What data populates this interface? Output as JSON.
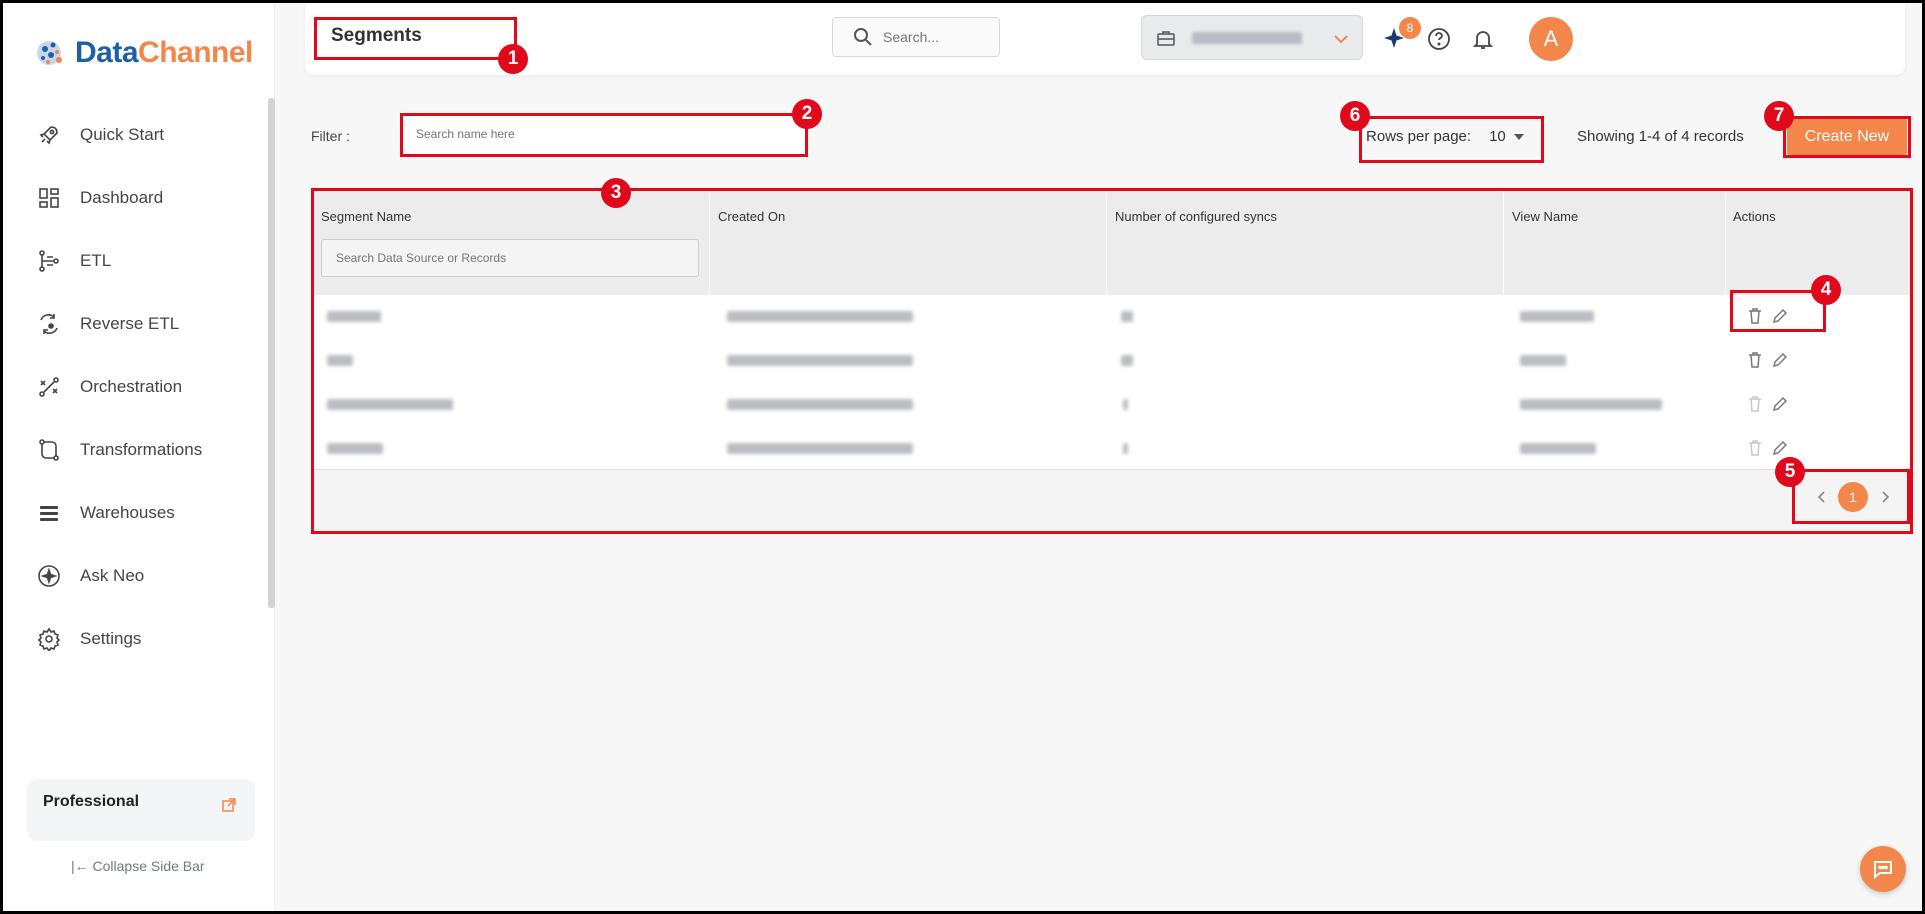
{
  "brand": {
    "name_part1": "Data",
    "name_part2": "Channel"
  },
  "sidebar": {
    "items": [
      {
        "label": "Quick Start",
        "icon": "rocket-icon"
      },
      {
        "label": "Dashboard",
        "icon": "dashboard-icon"
      },
      {
        "label": "ETL",
        "icon": "etl-icon"
      },
      {
        "label": "Reverse ETL",
        "icon": "reverse-etl-icon"
      },
      {
        "label": "Orchestration",
        "icon": "orchestration-icon"
      },
      {
        "label": "Transformations",
        "icon": "transformations-icon"
      },
      {
        "label": "Warehouses",
        "icon": "warehouses-icon"
      },
      {
        "label": "Ask Neo",
        "icon": "sparkle-icon"
      },
      {
        "label": "Settings",
        "icon": "gear-icon"
      }
    ],
    "plan": "Professional",
    "collapse_label": "|← Collapse Side Bar"
  },
  "header": {
    "title": "Segments",
    "search_placeholder": "Search...",
    "neo_badge_count": "8",
    "avatar_initial": "A"
  },
  "toolbar": {
    "filter_label": "Filter :",
    "filter_placeholder": "Search name here",
    "rows_per_page_label": "Rows per page:",
    "rows_per_page_value": "10",
    "showing_text": "Showing 1-4 of 4 records",
    "create_label": "Create New"
  },
  "table": {
    "columns": [
      "Segment Name",
      "Created On",
      "Number of configured syncs",
      "View Name",
      "Actions"
    ],
    "column_search_placeholder": "Search Data Source or Records",
    "rows": [
      {
        "segment_name": "(blurred)",
        "created_on": "(blurred)",
        "syncs": "(blurred)",
        "view_name": "(blurred)"
      },
      {
        "segment_name": "(blurred)",
        "created_on": "(blurred)",
        "syncs": "(blurred)",
        "view_name": "(blurred)"
      },
      {
        "segment_name": "(blurred)",
        "created_on": "(blurred)",
        "syncs": "(blurred)",
        "view_name": "(blurred)"
      },
      {
        "segment_name": "(blurred)",
        "created_on": "(blurred)",
        "syncs": "(blurred)",
        "view_name": "(blurred)"
      }
    ],
    "current_page": "1"
  },
  "annotations": [
    "1",
    "2",
    "3",
    "4",
    "5",
    "6",
    "7"
  ],
  "colors": {
    "accent": "#f2864b",
    "brand_blue": "#1f5fa8",
    "annotation_red": "#e0081b"
  }
}
